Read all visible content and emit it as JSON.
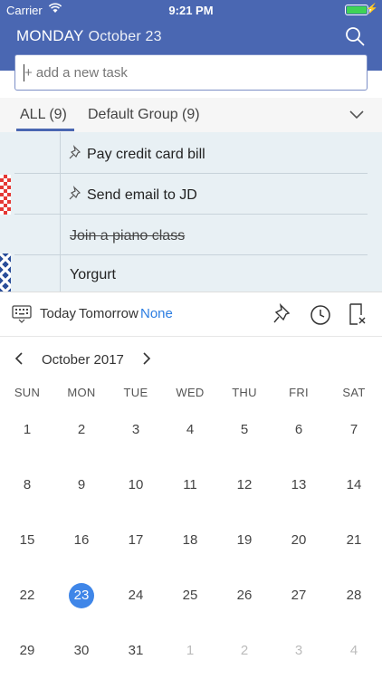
{
  "status_bar": {
    "carrier": "Carrier",
    "time": "9:21 PM",
    "bolt": "⚡"
  },
  "header": {
    "day": "MONDAY",
    "date": "October 23"
  },
  "task_input": {
    "placeholder": "+ add a new task"
  },
  "tabs": {
    "all": "ALL (9)",
    "default_group": "Default Group (9)"
  },
  "tasks": [
    {
      "text": "Pay credit card bill",
      "pinned": true,
      "done": false
    },
    {
      "text": "Send email to JD",
      "pinned": true,
      "done": false
    },
    {
      "text": "Join a piano class",
      "pinned": false,
      "done": true
    },
    {
      "text": "Yorgurt",
      "pinned": false,
      "done": false
    }
  ],
  "toolbar": {
    "today": "Today",
    "tomorrow": "Tomorrow",
    "none": "None"
  },
  "calendar": {
    "month": "October 2017",
    "weekdays": [
      "SUN",
      "MON",
      "TUE",
      "WED",
      "THU",
      "FRI",
      "SAT"
    ],
    "weeks": [
      [
        "1",
        "2",
        "3",
        "4",
        "5",
        "6",
        "7"
      ],
      [
        "8",
        "9",
        "10",
        "11",
        "12",
        "13",
        "14"
      ],
      [
        "15",
        "16",
        "17",
        "18",
        "19",
        "20",
        "21"
      ],
      [
        "22",
        "23",
        "24",
        "25",
        "26",
        "27",
        "28"
      ],
      [
        "29",
        "30",
        "31",
        "1",
        "2",
        "3",
        "4"
      ]
    ],
    "selected": "23"
  },
  "colors": {
    "header_blue": "#4a67b2",
    "accent_blue": "#3f86e8",
    "list_bg": "#e8f0f4"
  }
}
